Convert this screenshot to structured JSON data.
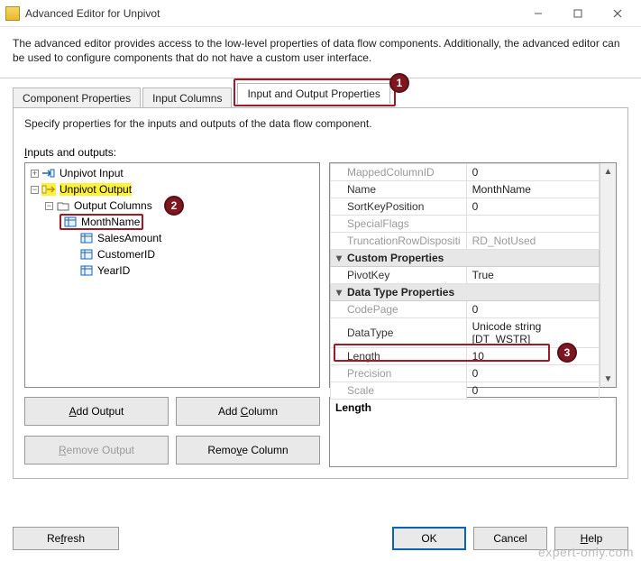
{
  "window": {
    "title": "Advanced Editor for Unpivot"
  },
  "description": "The advanced editor provides access to the low-level properties of data flow components. Additionally, the advanced editor can be used to configure components that do not have a custom user interface.",
  "tabs": {
    "component_properties": "Component Properties",
    "input_columns": "Input Columns",
    "io_properties": "Input and Output Properties"
  },
  "panel": {
    "subdesc": "Specify properties for the inputs and outputs of the data flow component.",
    "io_label": "Inputs and outputs:"
  },
  "tree": {
    "unpivot_input": "Unpivot Input",
    "unpivot_output": "Unpivot Output",
    "output_columns": "Output Columns",
    "month_name": "MonthName",
    "sales_amount": "SalesAmount",
    "customer_id": "CustomerID",
    "year_id": "YearID"
  },
  "props": {
    "mapped_id": {
      "k": "MappedColumnID",
      "v": "0"
    },
    "name": {
      "k": "Name",
      "v": "MonthName"
    },
    "sortkey": {
      "k": "SortKeyPosition",
      "v": "0"
    },
    "specialflags": {
      "k": "SpecialFlags",
      "v": ""
    },
    "truncation": {
      "k": "TruncationRowDispositi",
      "v": "RD_NotUsed"
    },
    "cat_custom": "Custom Properties",
    "pivotkey": {
      "k": "PivotKey",
      "v": "True"
    },
    "cat_dtype": "Data Type Properties",
    "codepage": {
      "k": "CodePage",
      "v": "0"
    },
    "datatype": {
      "k": "DataType",
      "v": "Unicode string [DT_WSTR]"
    },
    "length": {
      "k": "Length",
      "v": "10"
    },
    "precision": {
      "k": "Precision",
      "v": "0"
    },
    "scale": {
      "k": "Scale",
      "v": "0"
    }
  },
  "prop_help_title": "Length",
  "buttons": {
    "add_output": "Add Output",
    "add_column": "Add Column",
    "remove_output": "Remove Output",
    "remove_column": "Remove Column"
  },
  "footer": {
    "refresh": "Refresh",
    "ok": "OK",
    "cancel": "Cancel",
    "help": "Help"
  },
  "callouts": {
    "1": "1",
    "2": "2",
    "3": "3"
  },
  "watermark": "expert-only.com"
}
